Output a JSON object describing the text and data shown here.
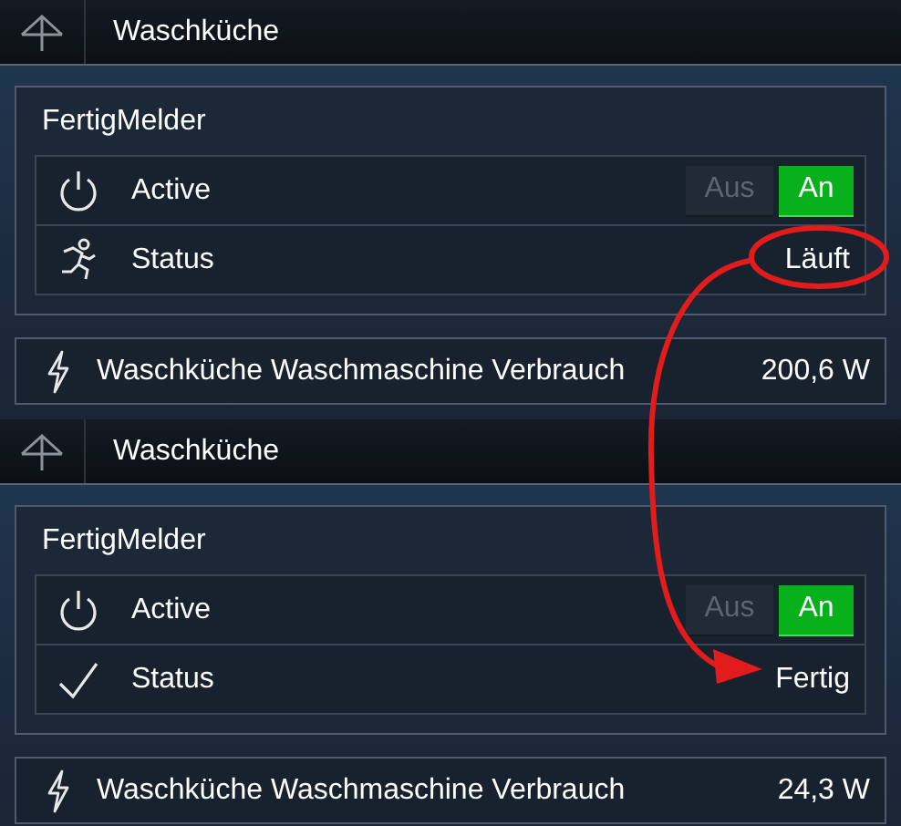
{
  "panels": [
    {
      "header": {
        "title": "Waschküche"
      },
      "group": {
        "title": "FertigMelder",
        "rows": [
          {
            "kind": "switch",
            "label": "Active",
            "options": [
              {
                "label": "Aus",
                "selected": false
              },
              {
                "label": "An",
                "selected": true
              }
            ]
          },
          {
            "kind": "status",
            "label": "Status",
            "value": "Läuft",
            "done": false
          }
        ]
      },
      "power": {
        "label": "Waschküche Waschmaschine Verbrauch",
        "value": "200,6 W"
      }
    },
    {
      "header": {
        "title": "Waschküche"
      },
      "group": {
        "title": "FertigMelder",
        "rows": [
          {
            "kind": "switch",
            "label": "Active",
            "options": [
              {
                "label": "Aus",
                "selected": false
              },
              {
                "label": "An",
                "selected": true
              }
            ]
          },
          {
            "kind": "status",
            "label": "Status",
            "value": "Fertig",
            "done": true
          }
        ]
      },
      "power": {
        "label": "Waschküche Waschmaschine Verbrauch",
        "value": "24,3 W"
      }
    }
  ],
  "annotation": {
    "kind": "circled-arrow"
  }
}
